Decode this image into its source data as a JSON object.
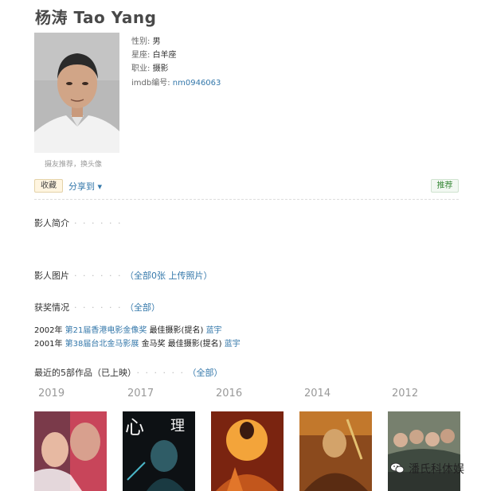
{
  "person": {
    "name": "杨涛 Tao Yang",
    "avatar_hint": "摄友推荐，换头像",
    "info": [
      {
        "key": "性别:",
        "value": "男"
      },
      {
        "key": "星座:",
        "value": "白羊座"
      },
      {
        "key": "职业:",
        "value": "摄影"
      },
      {
        "key": "imdb编号:",
        "value": "nm0946063"
      }
    ]
  },
  "actions": {
    "collect": "收藏",
    "share": "分享到 ▾",
    "recommend": "推荐"
  },
  "sections": {
    "bio": {
      "title": "影人简介",
      "dots": "· · · · · ·"
    },
    "photos": {
      "title": "影人图片",
      "dots": "· · · · · ·",
      "all": "（全部0张",
      "upload": "上传照片）"
    },
    "awards": {
      "title": "获奖情况",
      "dots": "· · · · · ·",
      "all": "（全部）"
    },
    "recent": {
      "title": "最近的5部作品（已上映）",
      "dots": "· · · · · ·",
      "all": "（全部）"
    }
  },
  "awards": [
    {
      "year": "2002年",
      "event": "第21届香港电影金像奖",
      "category": "最佳摄影(提名)",
      "film": "蓝宇"
    },
    {
      "year": "2001年",
      "event": "第38届台北金马影展",
      "category": "金马奖 最佳摄影(提名)",
      "film": "蓝宇"
    }
  ],
  "works": [
    {
      "year": "2019"
    },
    {
      "year": "2017"
    },
    {
      "year": "2016"
    },
    {
      "year": "2014"
    },
    {
      "year": "2012"
    }
  ],
  "watermark": {
    "text": "潘氏科体娱"
  },
  "colors": {
    "link": "#3377aa",
    "title": "#494949"
  }
}
